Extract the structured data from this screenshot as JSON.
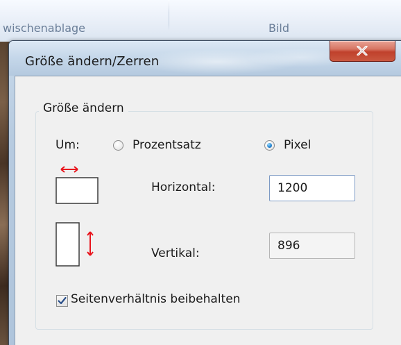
{
  "background": {
    "ribbon_groups": [
      "wischenablage",
      "Bild"
    ]
  },
  "dialog": {
    "title": "Größe ändern/Zerren",
    "close_glyph": "X",
    "resize_group": {
      "legend": "Größe ändern",
      "by_label": "Um:",
      "options": [
        {
          "label": "Prozentsatz",
          "selected": false
        },
        {
          "label": "Pixel",
          "selected": true
        }
      ],
      "horizontal_label": "Horizontal:",
      "horizontal_value": "1200",
      "vertical_label": "Vertikal:",
      "vertical_value": "896",
      "keep_ratio_label": "Seitenverhältnis beibehalten",
      "keep_ratio_checked": true
    }
  },
  "colors": {
    "arrow_red": "#e8141c",
    "radio_blue": "#2f8fd8",
    "close_red": "#c0412c"
  },
  "icons": [
    "horizontal-resize-icon",
    "vertical-resize-icon",
    "close-icon",
    "checkmark-icon",
    "radio-dot-icon"
  ]
}
